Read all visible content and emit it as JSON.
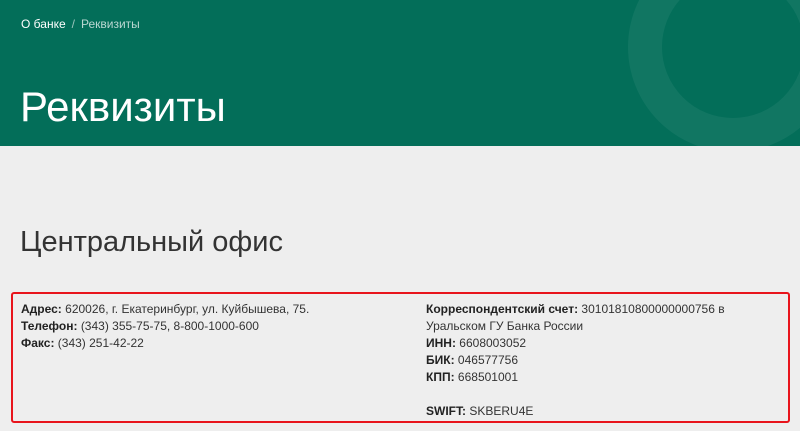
{
  "breadcrumb": {
    "parent": "О банке",
    "separator": "/",
    "current": "Реквизиты"
  },
  "page_title": "Реквизиты",
  "section_title": "Центральный офис",
  "details": {
    "left": {
      "address": {
        "label": "Адрес:",
        "value": "620026, г. Екатеринбург, ул. Куйбышева, 75."
      },
      "phone": {
        "label": "Телефон:",
        "value": "(343) 355-75-75, 8-800-1000-600"
      },
      "fax": {
        "label": "Факс:",
        "value": "(343) 251-42-22"
      }
    },
    "right": {
      "corr_account": {
        "label": "Корреспондентский счет:",
        "value": "30101810800000000756 в Уральском ГУ Банка России"
      },
      "inn": {
        "label": "ИНН:",
        "value": "6608003052"
      },
      "bik": {
        "label": "БИК:",
        "value": "046577756"
      },
      "kpp": {
        "label": "КПП:",
        "value": "668501001"
      },
      "swift": {
        "label": "SWIFT:",
        "value": "SKBERU4E"
      }
    }
  },
  "colors": {
    "header_bg": "#036e59",
    "page_bg": "#eeeeee",
    "highlight_border": "#e8141c"
  }
}
